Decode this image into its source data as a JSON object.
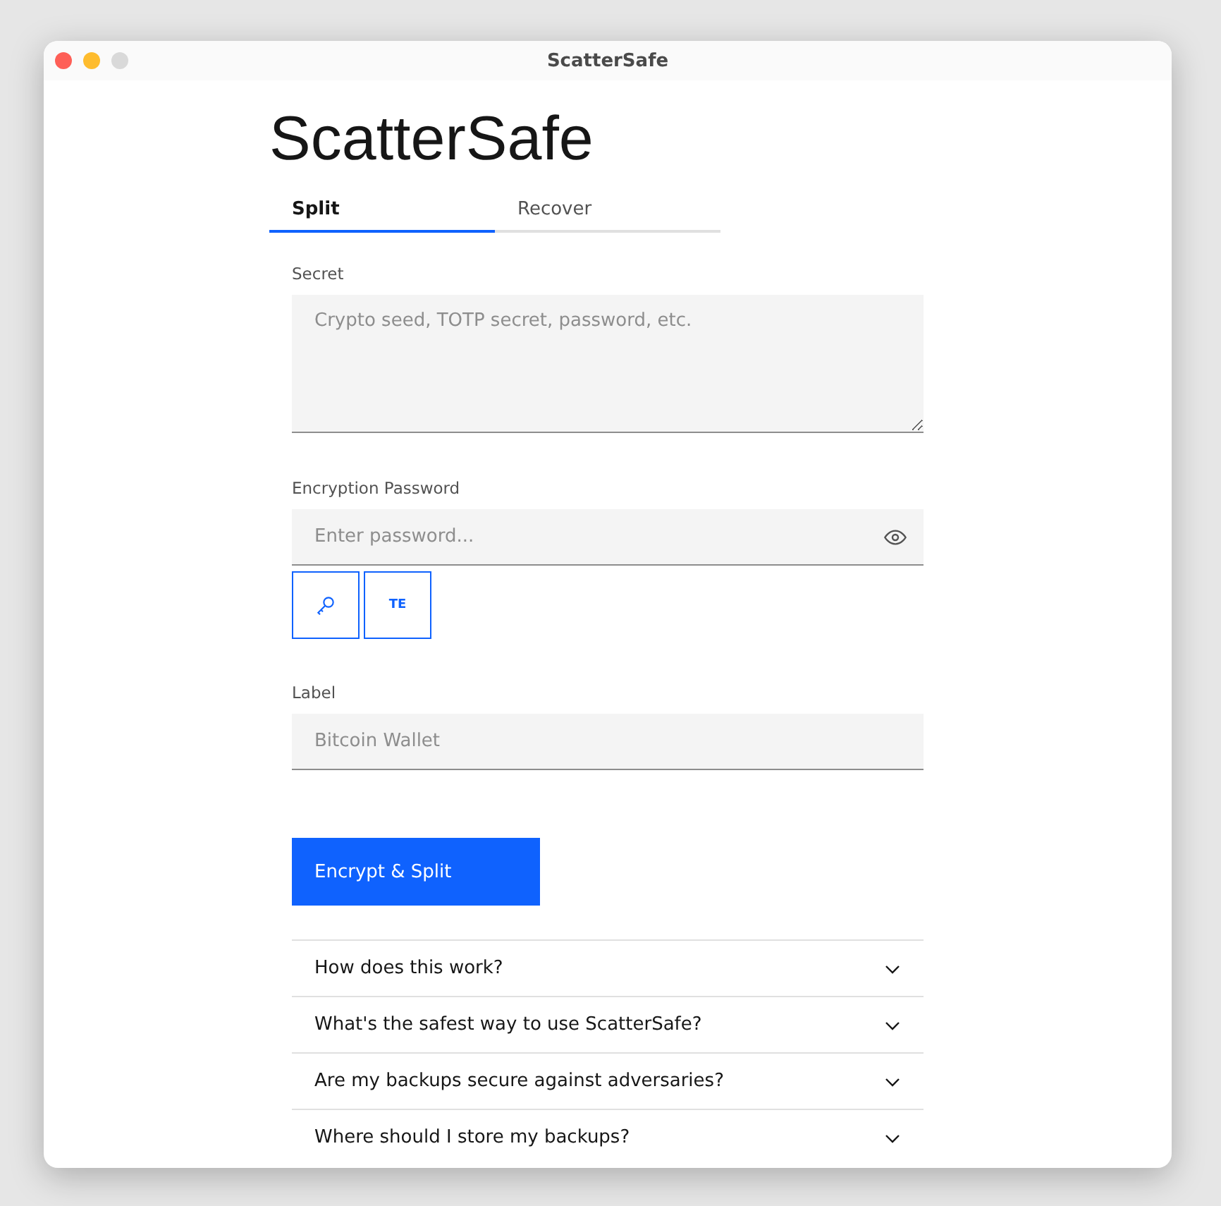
{
  "window": {
    "title": "ScatterSafe"
  },
  "app_title": "ScatterSafe",
  "tabs": [
    {
      "label": "Split",
      "selected": true
    },
    {
      "label": "Recover",
      "selected": false
    }
  ],
  "secret": {
    "label": "Secret",
    "placeholder": "Crypto seed, TOTP secret, password, etc."
  },
  "password": {
    "label": "Encryption Password",
    "placeholder": "Enter password..."
  },
  "password_tools": {
    "text_button": "TE"
  },
  "label_field": {
    "label": "Label",
    "placeholder": "Bitcoin Wallet"
  },
  "submit": "Encrypt & Split",
  "faq": [
    {
      "question": "How does this work?",
      "expanded": false
    },
    {
      "question": "What's the safest way to use ScatterSafe?",
      "expanded": false
    },
    {
      "question": "Are my backups secure against adversaries?",
      "expanded": false
    },
    {
      "question": "Where should I store my backups?",
      "expanded": false
    }
  ]
}
